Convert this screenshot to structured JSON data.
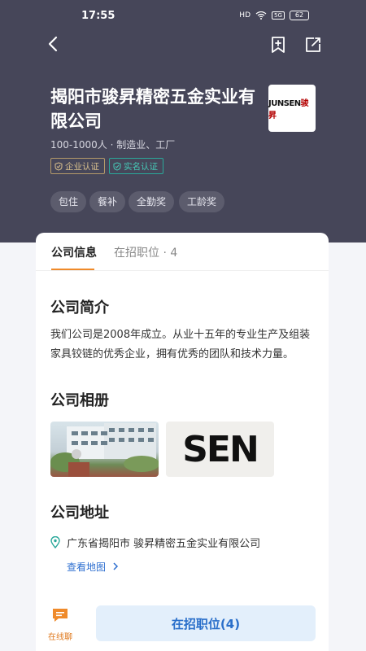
{
  "status_bar": {
    "time": "17:55",
    "network": "HD",
    "signal": "5G",
    "battery": "62"
  },
  "header": {
    "company_name": "揭阳市骏昇精密五金实业有限公司",
    "meta": "100-1000人 · 制造业、工厂",
    "badges": [
      {
        "label": "企业认证",
        "color": "#d9c08e"
      },
      {
        "label": "实名认证",
        "color": "#46c8b6"
      }
    ],
    "logo": {
      "brand": "JUNSEN",
      "cn": "骏昇"
    },
    "tags": [
      "包住",
      "餐补",
      "全勤奖",
      "工龄奖"
    ]
  },
  "tabs": {
    "info": "公司信息",
    "jobs": "在招职位 · 4"
  },
  "intro": {
    "title": "公司简介",
    "text": "我们公司是2008年成立。从业十五年的专业生产及组装家具铰链的优秀企业，拥有优秀的团队和技术力量。"
  },
  "album": {
    "title": "公司相册",
    "photo2_text": "SEN"
  },
  "address": {
    "title": "公司地址",
    "text": "广东省揭阳市 骏昇精密五金实业有限公司",
    "map_link": "查看地图"
  },
  "bottom": {
    "chat_label": "在线聊",
    "jobs_button": "在招职位(4)"
  },
  "colors": {
    "header_bg": "#464659",
    "accent_orange": "#ef8a2a",
    "link_blue": "#2e6fd0"
  }
}
